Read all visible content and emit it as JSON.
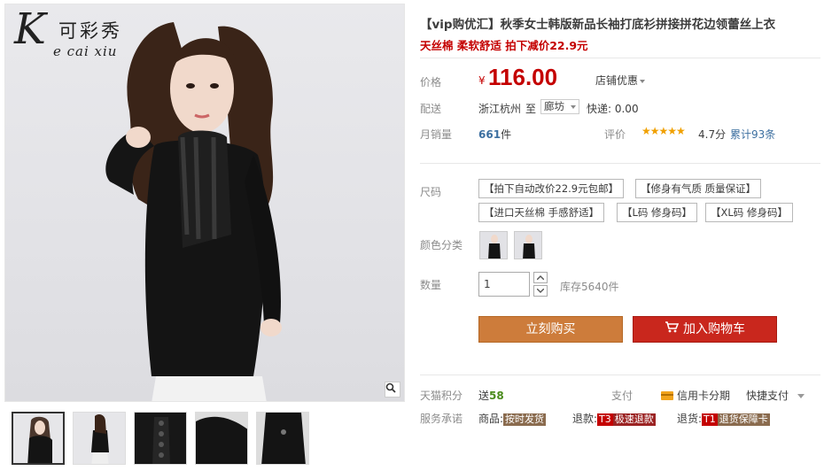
{
  "brand": {
    "logo_letter": "K",
    "logo_chinese": "可彩秀",
    "logo_english": "e cai xiu"
  },
  "product": {
    "title": "【vip购优汇】秋季女士韩版新品长袖打底衫拼接拼花边领蕾丝上衣",
    "subtitle": "天丝棉 柔软舒适 拍下减价22.9元"
  },
  "price": {
    "label": "价格",
    "currency": "¥",
    "value": "116.00",
    "shop_discount": "店铺优惠"
  },
  "shipping": {
    "label": "配送",
    "from": "浙江杭州",
    "to_word": "至",
    "destination": "廊坊",
    "fee": "快递: 0.00"
  },
  "sales": {
    "label": "月销量",
    "count": "661",
    "unit": "件"
  },
  "rating": {
    "label": "评价",
    "stars": "★★★★★",
    "score": "4.7分",
    "total": "累计93条",
    "value": 4.7
  },
  "sku": {
    "label": "尺码",
    "options": [
      "【拍下自动改价22.9元包邮】",
      "【修身有气质 质量保证】",
      "【进口天丝棉 手感舒适】",
      "【L码 修身码】",
      "【XL码 修身码】"
    ]
  },
  "color": {
    "label": "颜色分类"
  },
  "quantity": {
    "label": "数量",
    "value": "1",
    "stock": "库存5640件"
  },
  "buttons": {
    "buy": "立刻购买",
    "cart": "加入购物车"
  },
  "points": {
    "label": "天猫积分",
    "prefix": "送",
    "value": "58"
  },
  "payment": {
    "label": "支付",
    "credit": "信用卡分期",
    "express": "快捷支付"
  },
  "service": {
    "label": "服务承诺",
    "goods": "商品:",
    "goods_badge": "按时发货",
    "refund": "退款:",
    "refund_t3": "T3",
    "refund_badge": "极速退款",
    "return": "退货:",
    "return_t1": "T1",
    "return_badge": "退货保障卡"
  },
  "colors": {
    "price_red": "#c40000",
    "buy_orange": "#cd7c3b",
    "cart_red": "#c9271d"
  },
  "icons": [
    "magnifier-icon",
    "cart-icon",
    "credit-card-icon",
    "chevron-down-icon",
    "star-icon"
  ]
}
